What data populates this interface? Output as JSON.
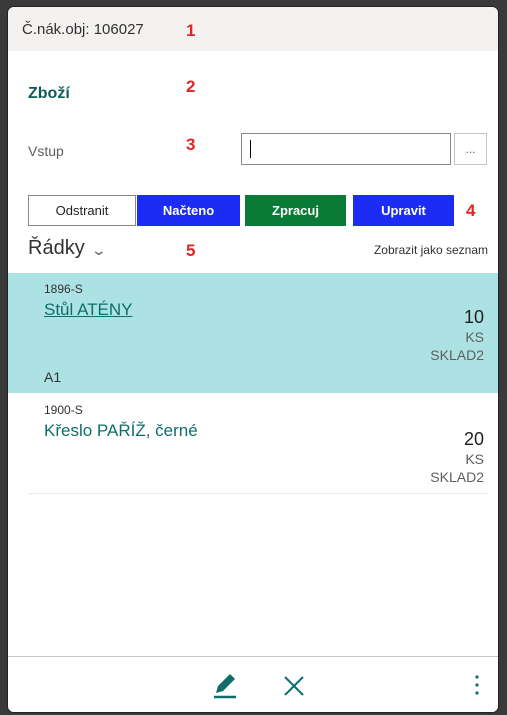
{
  "header": {
    "title": "Č.nák.obj: 106027"
  },
  "markers": [
    "1",
    "2",
    "3",
    "4",
    "5"
  ],
  "section": {
    "title": "Zboží"
  },
  "input": {
    "label": "Vstup",
    "value": "",
    "lookup_label": "..."
  },
  "actions": {
    "remove": "Odstranit",
    "loaded": "Načteno",
    "process": "Zpracuj",
    "edit": "Upravit"
  },
  "lines": {
    "title": "Řádky",
    "view_toggle": "Zobrazit jako seznam",
    "items": [
      {
        "code": "1896-S",
        "name": "Stůl ATÉNY",
        "qty": "10",
        "unit": "KS",
        "location": "SKLAD2",
        "bin": "A1",
        "selected": true
      },
      {
        "code": "1900-S",
        "name": "Křeslo PAŘÍŽ, černé",
        "qty": "20",
        "unit": "KS",
        "location": "SKLAD2",
        "bin": "",
        "selected": false
      }
    ]
  },
  "footer": {
    "icons": [
      "edit-icon",
      "close-icon",
      "more-icon"
    ]
  },
  "colors": {
    "accent": "#0e6e6c",
    "blue_button": "#1b2cf5",
    "green_button": "#0a7b36",
    "selected_row": "#ade2e5",
    "marker": "#e32424"
  }
}
